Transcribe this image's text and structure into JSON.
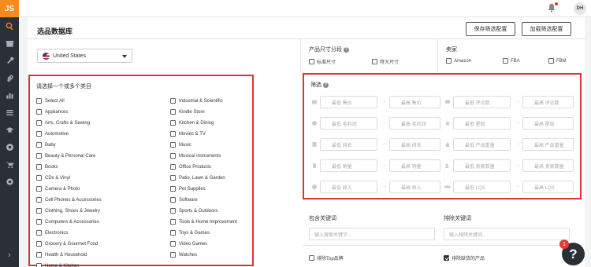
{
  "logo": "JS",
  "topbar": {
    "avatar": "DH"
  },
  "page": {
    "title": "选品数据库",
    "save_filter": "保存筛选配置",
    "load_filter": "加载筛选配置"
  },
  "market": {
    "selected": "United States"
  },
  "size_tier": {
    "label": "产品尺寸分段",
    "options": [
      {
        "label": "标准尺寸",
        "checked": false
      },
      {
        "label": "特大尺寸",
        "checked": false
      }
    ]
  },
  "seller": {
    "label": "卖家",
    "options": [
      {
        "label": "Amazon",
        "checked": false
      },
      {
        "label": "FBA",
        "checked": false
      },
      {
        "label": "FBM",
        "checked": false
      }
    ]
  },
  "categories": {
    "title": "请选择一个或多个类目",
    "col1": [
      "Select All",
      "Appliances",
      "Arts, Crafts & Sewing",
      "Automotive",
      "Baby",
      "Beauty & Personal Care",
      "Books",
      "CDs & Vinyl",
      "Camera & Photo",
      "Cell Phones & Accessories",
      "Clothing, Shoes & Jewelry",
      "Computers & Accessories",
      "Electronics",
      "Grocery & Gourmet Food",
      "Health & Household",
      "Home & Kitchen"
    ],
    "col2": [
      "Industrial & Scientific",
      "Kindle Store",
      "Kitchen & Dining",
      "Movies & TV",
      "Music",
      "Musical Instruments",
      "Office Products",
      "Patio, Lawn & Garden",
      "Pet Supplies",
      "Software",
      "Sports & Outdoors",
      "Tools & Home Improvement",
      "Toys & Games",
      "Video Games",
      "Watches"
    ]
  },
  "filters": {
    "title": "筛选",
    "left": [
      {
        "icon": "price-icon",
        "min": "最低 售价",
        "max": "最高 售价"
      },
      {
        "icon": "profit-icon",
        "min": "最低 毛利润",
        "max": "最高 毛利润"
      },
      {
        "icon": "rank-icon",
        "min": "最低 排名",
        "max": "最高 排名"
      },
      {
        "icon": "sales-icon",
        "min": "最低 销量",
        "max": "最高 销量"
      },
      {
        "icon": "revenue-icon",
        "min": "最低 收入",
        "max": "最高 收入"
      }
    ],
    "right": [
      {
        "icon": "reviews-icon",
        "min": "最低 评论数",
        "max": "最高 评论数"
      },
      {
        "icon": "star-icon",
        "min": "最低 星级",
        "max": "最高 星级"
      },
      {
        "icon": "weight-icon",
        "min": "最低 产品重量",
        "max": "最高 产品重量"
      },
      {
        "icon": "sellers-icon",
        "min": "最低 卖家数量",
        "max": "最高 卖家数量"
      },
      {
        "icon": "lqs-icon",
        "min": "最低 LQS",
        "max": "最高 LQS"
      }
    ]
  },
  "keywords": {
    "include_label": "包含关键词",
    "include_placeholder": "输入搜索关键字...",
    "exclude_label": "排除关键词",
    "exclude_placeholder": "输入排除关键词..."
  },
  "bottom": {
    "exclude_top": "排除Top品牌",
    "exclude_top_checked": false,
    "exclude_missing": "排除缺货的产品",
    "exclude_missing_checked": true
  },
  "help_bubble": {
    "label": "?",
    "badge": "1"
  },
  "colors": {
    "accent": "#f38b1e",
    "highlight_border": "#dd3333",
    "rail": "#2b2f36"
  }
}
